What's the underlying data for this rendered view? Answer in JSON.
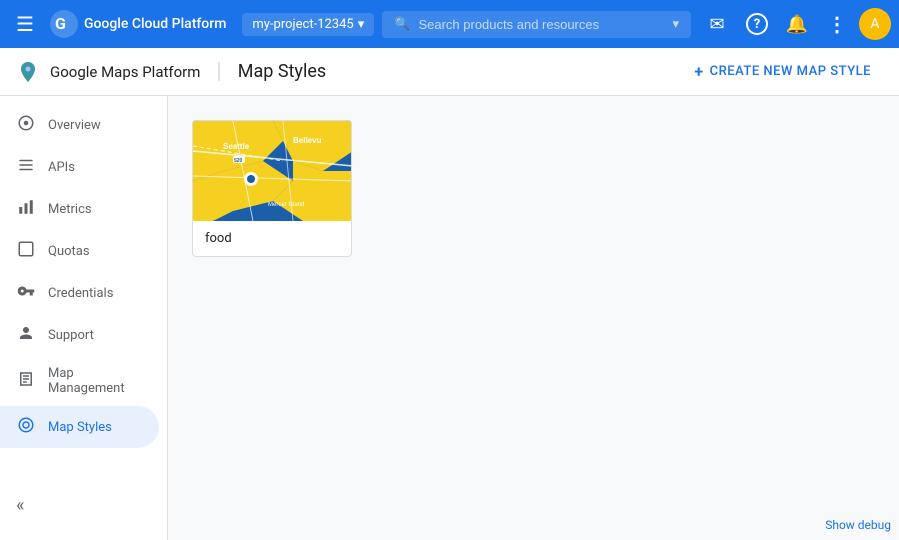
{
  "topBar": {
    "menuIcon": "☰",
    "appTitle": "Google Cloud Platform",
    "projectName": "my-project-12345",
    "searchPlaceholder": "Search products and resources",
    "icons": {
      "email": "✉",
      "help": "?",
      "bell": "🔔",
      "more": "⋮"
    },
    "avatarLetter": "A"
  },
  "subHeader": {
    "brandIcon": "maps",
    "brandName": "Google Maps Platform",
    "divider": "|",
    "pageTitle": "Map Styles",
    "createButtonIcon": "＋",
    "createButtonLabel": "CREATE NEW MAP STYLE"
  },
  "sidebar": {
    "items": [
      {
        "id": "overview",
        "label": "Overview",
        "icon": "⊙",
        "active": false
      },
      {
        "id": "apis",
        "label": "APIs",
        "icon": "≡",
        "active": false
      },
      {
        "id": "metrics",
        "label": "Metrics",
        "icon": "📊",
        "active": false
      },
      {
        "id": "quotas",
        "label": "Quotas",
        "icon": "□",
        "active": false
      },
      {
        "id": "credentials",
        "label": "Credentials",
        "icon": "🔑",
        "active": false
      },
      {
        "id": "support",
        "label": "Support",
        "icon": "👤",
        "active": false
      },
      {
        "id": "map-management",
        "label": "Map Management",
        "icon": "▦",
        "active": false
      },
      {
        "id": "map-styles",
        "label": "Map Styles",
        "icon": "◎",
        "active": true
      }
    ],
    "collapseIcon": "«"
  },
  "main": {
    "mapStyles": [
      {
        "id": "food",
        "label": "food"
      }
    ]
  },
  "footer": {
    "showDebug": "Show debug"
  },
  "colors": {
    "topBarBg": "#1a73e8",
    "sidebarActiveBg": "#e8f0fe",
    "sidebarActiveColor": "#1a73e8",
    "createBtnColor": "#1a73e8"
  }
}
